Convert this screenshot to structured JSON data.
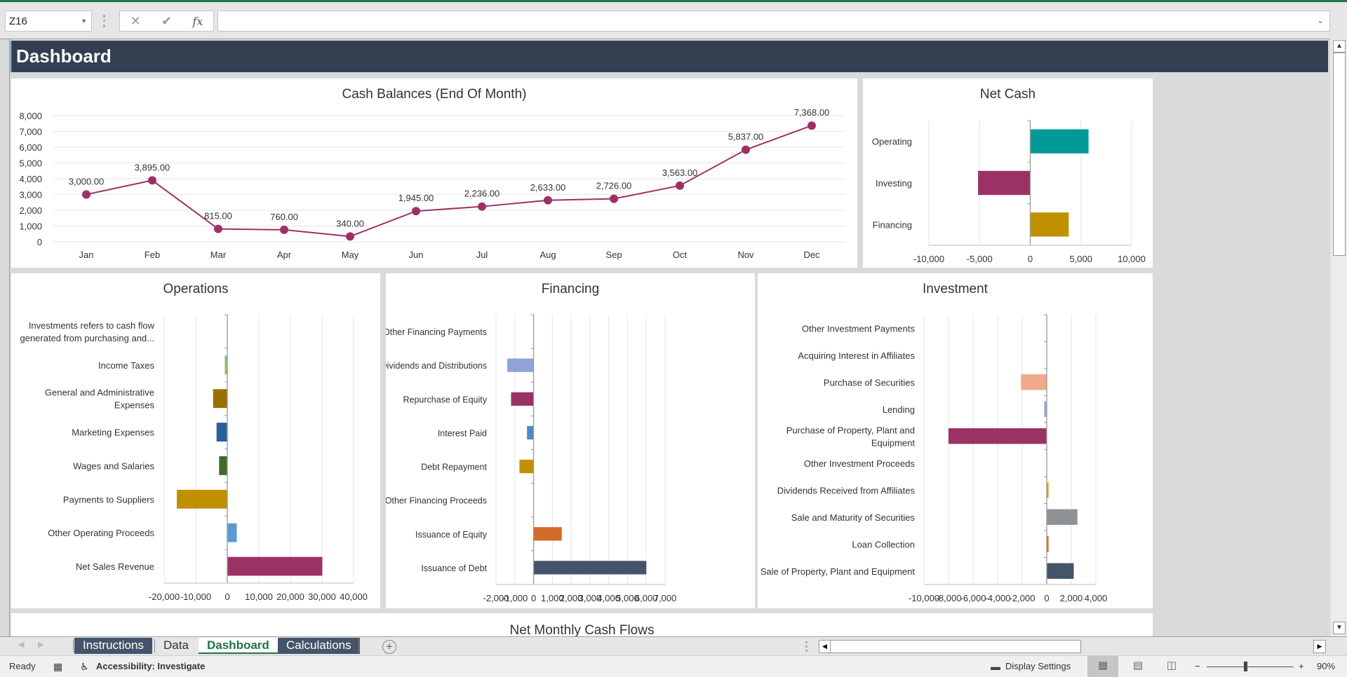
{
  "formula_bar": {
    "name_box": "Z16",
    "cancel_icon": "✕",
    "enter_icon": "✔",
    "fx_label": "fx",
    "formula_value": ""
  },
  "sheet": {
    "header_title": "Dashboard"
  },
  "charts": [
    {
      "id": "cash-balances",
      "type": "line",
      "title": "Cash Balances (End Of Month)",
      "categories": [
        "Jan",
        "Feb",
        "Mar",
        "Apr",
        "May",
        "Jun",
        "Jul",
        "Aug",
        "Sep",
        "Oct",
        "Nov",
        "Dec"
      ],
      "values": [
        3000,
        3895,
        815,
        760,
        340,
        1945,
        2236,
        2633,
        2726,
        3563,
        5837,
        7368
      ],
      "data_labels": [
        "3,000.00",
        "3,895.00",
        "815.00",
        "760.00",
        "340.00",
        "1,945.00",
        "2,236.00",
        "2,633.00",
        "2,726.00",
        "3,563.00",
        "5,837.00",
        "7,368.00"
      ],
      "y_ticks": [
        "0",
        "1,000",
        "2,000",
        "3,000",
        "4,000",
        "5,000",
        "6,000",
        "7,000",
        "8,000"
      ],
      "ylim": [
        0,
        8000
      ],
      "grid": true,
      "color": "#9b3266"
    },
    {
      "id": "net-cash",
      "type": "bar",
      "orientation": "horizontal",
      "title": "Net Cash",
      "categories": [
        "Operating",
        "Investing",
        "Financing"
      ],
      "values": [
        5750,
        -5150,
        3800
      ],
      "colors": [
        "#009999",
        "#9b3266",
        "#c09000"
      ],
      "x_ticks": [
        "-10,000",
        "-5,000",
        "0",
        "5,000",
        "10,000"
      ],
      "xlim": [
        -10000,
        10000
      ],
      "grid": true
    },
    {
      "id": "operations",
      "type": "bar",
      "orientation": "horizontal",
      "title": "Operations",
      "categories": [
        "Investments refers to cash flow generated from purchasing and...",
        "Income Taxes",
        "General and Administrative Expenses",
        "Marketing Expenses",
        "Wages and Salaries",
        "Payments to Suppliers",
        "Other Operating Proceeds",
        "Net Sales Revenue"
      ],
      "values": [
        0,
        -800,
        -4500,
        -3400,
        -2600,
        -16000,
        3000,
        30100
      ],
      "colors": [
        "#ffffff",
        "#8cc068",
        "#9a7000",
        "#25609a",
        "#43682b",
        "#c09000",
        "#5b9bd5",
        "#9b3266"
      ],
      "x_ticks": [
        "-20,000",
        "-10,000",
        "0",
        "10,000",
        "20,000",
        "30,000",
        "40,000"
      ],
      "xlim": [
        -20000,
        40000
      ],
      "grid": true
    },
    {
      "id": "financing",
      "type": "bar",
      "orientation": "horizontal",
      "title": "Financing",
      "categories": [
        "Other Financing Payments",
        "Dividends and Distributions",
        "Repurchase of Equity",
        "Interest Paid",
        "Debt Repayment",
        "Other Financing Proceeds",
        "Issuance of Equity",
        "Issuance of Debt"
      ],
      "values": [
        0,
        -1400,
        -1200,
        -350,
        -750,
        0,
        1500,
        6000
      ],
      "colors": [
        "#ffffff",
        "#8fa4d4",
        "#9b3266",
        "#4f88c0",
        "#c09000",
        "#ffffff",
        "#d36b28",
        "#44546a"
      ],
      "x_ticks": [
        "-2,000",
        "-1,000",
        "0",
        "1,000",
        "2,000",
        "3,000",
        "4,000",
        "5,000",
        "6,000",
        "7,000"
      ],
      "xlim": [
        -2000,
        7000
      ],
      "grid": true
    },
    {
      "id": "investment",
      "type": "bar",
      "orientation": "horizontal",
      "title": "Investment",
      "categories": [
        "Other Investment Payments",
        "Acquiring Interest in Affiliates",
        "Purchase of Securities",
        "Lending",
        "Purchase of Property, Plant and Equipment",
        "Other Investment Proceeds",
        "Dividends Received from Affiliates",
        "Sale and Maturity of Securities",
        "Loan Collection",
        "Sale of Property, Plant and Equipment"
      ],
      "values": [
        0,
        0,
        -2100,
        -200,
        -8000,
        0,
        150,
        2500,
        150,
        2200
      ],
      "colors": [
        "#ffffff",
        "#ffffff",
        "#f0a98a",
        "#8fa4d4",
        "#9b3266",
        "#ffffff",
        "#e0a800",
        "#8e9196",
        "#d36b28",
        "#44546a"
      ],
      "x_ticks": [
        "-10,000",
        "-8,000",
        "-6,000",
        "-4,000",
        "-2,000",
        "0",
        "2,000",
        "4,000"
      ],
      "xlim": [
        -10000,
        4000
      ],
      "grid": true
    },
    {
      "id": "net-monthly",
      "type": "bar",
      "title": "Net Monthly Cash Flows"
    }
  ],
  "chart_data": [
    {
      "type": "line",
      "title": "Cash Balances (End Of Month)",
      "categories": [
        "Jan",
        "Feb",
        "Mar",
        "Apr",
        "May",
        "Jun",
        "Jul",
        "Aug",
        "Sep",
        "Oct",
        "Nov",
        "Dec"
      ],
      "values": [
        3000,
        3895,
        815,
        760,
        340,
        1945,
        2236,
        2633,
        2726,
        3563,
        5837,
        7368
      ],
      "xlabel": "",
      "ylabel": "",
      "ylim": [
        0,
        8000
      ]
    },
    {
      "type": "bar",
      "title": "Net Cash",
      "categories": [
        "Operating",
        "Investing",
        "Financing"
      ],
      "values": [
        5750,
        -5150,
        3800
      ],
      "xlim": [
        -10000,
        10000
      ]
    },
    {
      "type": "bar",
      "title": "Operations",
      "categories": [
        "Investments refers to cash flow generated from purchasing and...",
        "Income Taxes",
        "General and Administrative Expenses",
        "Marketing Expenses",
        "Wages and Salaries",
        "Payments to Suppliers",
        "Other Operating Proceeds",
        "Net Sales Revenue"
      ],
      "values": [
        0,
        -800,
        -4500,
        -3400,
        -2600,
        -16000,
        3000,
        30100
      ],
      "xlim": [
        -20000,
        40000
      ]
    },
    {
      "type": "bar",
      "title": "Financing",
      "categories": [
        "Other Financing Payments",
        "Dividends and Distributions",
        "Repurchase of Equity",
        "Interest Paid",
        "Debt Repayment",
        "Other Financing Proceeds",
        "Issuance of Equity",
        "Issuance of Debt"
      ],
      "values": [
        0,
        -1400,
        -1200,
        -350,
        -750,
        0,
        1500,
        6000
      ],
      "xlim": [
        -2000,
        7000
      ]
    },
    {
      "type": "bar",
      "title": "Investment",
      "categories": [
        "Other Investment Payments",
        "Acquiring Interest in Affiliates",
        "Purchase of Securities",
        "Lending",
        "Purchase of Property, Plant and Equipment",
        "Other Investment Proceeds",
        "Dividends Received from Affiliates",
        "Sale and Maturity of Securities",
        "Loan Collection",
        "Sale of Property, Plant and Equipment"
      ],
      "values": [
        0,
        0,
        -2100,
        -200,
        -8000,
        0,
        150,
        2500,
        150,
        2200
      ],
      "xlim": [
        -10000,
        4000
      ]
    },
    {
      "type": "bar",
      "title": "Net Monthly Cash Flows"
    }
  ],
  "tabs": [
    {
      "label": "Instructions",
      "style": "dark"
    },
    {
      "label": "Data",
      "style": "plain"
    },
    {
      "label": "Dashboard",
      "style": "active"
    },
    {
      "label": "Calculations",
      "style": "dark"
    }
  ],
  "status_bar": {
    "ready": "Ready",
    "accessibility": "Accessibility: Investigate",
    "display_settings": "Display Settings",
    "zoom_minus": "−",
    "zoom_plus": "+",
    "zoom_level": "90%",
    "zoom_percent": 90
  }
}
